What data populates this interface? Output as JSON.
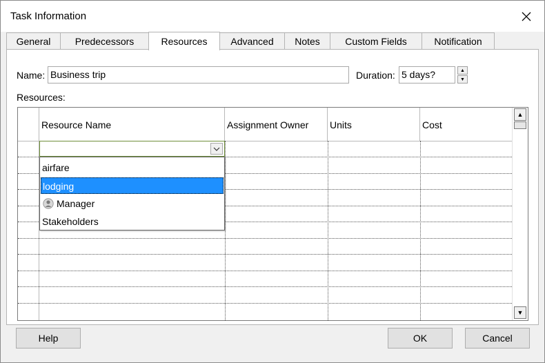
{
  "window": {
    "title": "Task Information"
  },
  "tabs": [
    {
      "label": "General"
    },
    {
      "label": "Predecessors"
    },
    {
      "label": "Resources",
      "active": true
    },
    {
      "label": "Advanced"
    },
    {
      "label": "Notes"
    },
    {
      "label": "Custom Fields"
    },
    {
      "label": "Notification"
    }
  ],
  "form": {
    "name_label": "Name:",
    "name_value": "Business trip",
    "duration_label": "Duration:",
    "duration_value": "5 days?",
    "resources_label": "Resources:"
  },
  "grid": {
    "columns": [
      "Resource Name",
      "Assignment Owner",
      "Units",
      "Cost"
    ],
    "rows_visible": 11
  },
  "dropdown": {
    "current_value": "",
    "options": [
      {
        "label": "airfare",
        "icon": ""
      },
      {
        "label": "lodging",
        "icon": "",
        "selected": true
      },
      {
        "label": "Manager",
        "icon": "person-icon"
      },
      {
        "label": "Stakeholders",
        "icon": ""
      }
    ]
  },
  "buttons": {
    "help": "Help",
    "ok": "OK",
    "cancel": "Cancel"
  },
  "colors": {
    "highlight": "#1e90ff",
    "combo_border": "#6f8f3a"
  }
}
